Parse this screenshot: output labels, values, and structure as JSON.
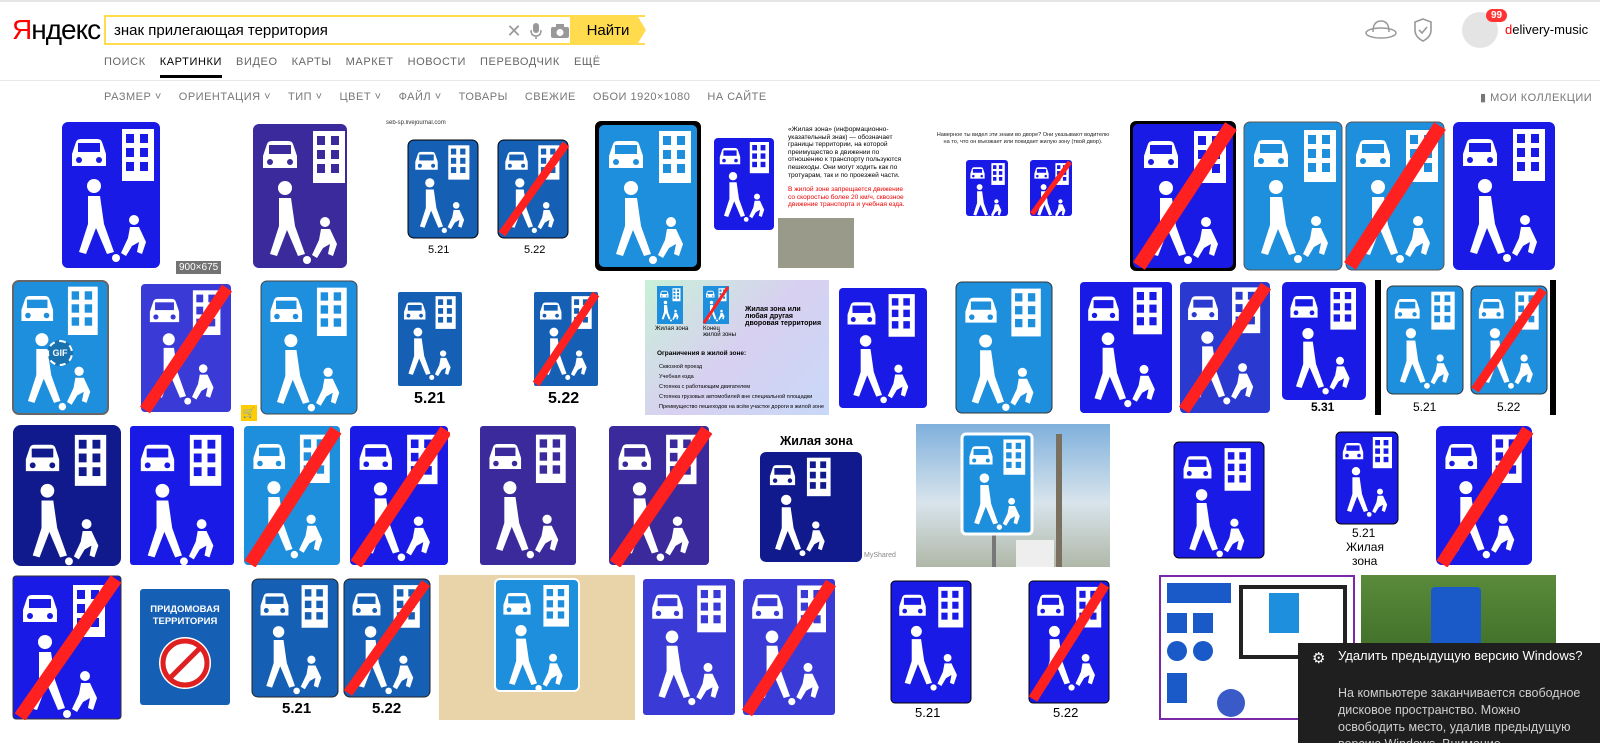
{
  "header": {
    "logo_first": "Я",
    "logo_rest": "ндекс",
    "search_value": "знак прилегающая территория",
    "find_label": "Найти",
    "badge_count": "99",
    "username_first": "d",
    "username_rest": "elivery-music"
  },
  "nav": {
    "items": [
      "ПОИСК",
      "КАРТИНКИ",
      "ВИДЕО",
      "КАРТЫ",
      "МАРКЕТ",
      "НОВОСТИ",
      "ПЕРЕВОДЧИК",
      "ЕЩЁ"
    ]
  },
  "filters": {
    "items": [
      "РАЗМЕР ˅",
      "ОРИЕНТАЦИЯ ˅",
      "ТИП ˅",
      "ЦВЕТ ˅",
      "ФАЙЛ ˅",
      "ТОВАРЫ",
      "СВЕЖИЕ",
      "ОБОИ 1920×1080",
      "НА САЙТЕ"
    ],
    "collections": "МОИ КОЛЛЕКЦИИ"
  },
  "results": {
    "resolution_badge": "900×675",
    "gif_label": "GIF",
    "site_caption": "seb-sp.livejournal.com",
    "label_521": "5.21",
    "label_522": "5.22",
    "label_531": "5.31",
    "zhilaya_zona": "Жилая зона",
    "zona_word": "зона",
    "zhilaya_word": "Жилая",
    "myshared": "MyShared",
    "pridomovaya_line1": "ПРИДОМОВАЯ",
    "pridomovaya_line2": "ТЕРРИТОРИЯ",
    "tile5_head": "«Жилая зона» (информационно-указательный знак) — обозначает границы территории, на которой преимущество в движении по отношению к транспорту пользуются пешеходы. Они могут ходить как по тротуарам, так и по проезжей части.",
    "tile5_red": "В жилой зоне запрещается движение со скоростью более 20 км/ч, сквозное движение транспорта и учебная езда.",
    "tile6_text": "Наверное ты видел эти знаки во дворе? Они указывают водителю на то, что он въезжает или покидает жилую зону (твой двор).",
    "tile14_title": "Жилая зона или любая другая дворовая территория",
    "tile14_l1": "Жилая зона",
    "tile14_l2": "Конец жилой зоны",
    "tile14_head": "Ограничения в жилой зоне:",
    "tile14_items": [
      "Сквозной проезд",
      "Учебная езда",
      "Стоянка с работающим двигателем",
      "Стоянка грузовых автомобилей вне специальной площадки",
      "Преимущество пешеходов на всём участке дороги в жилой зоне"
    ]
  },
  "toast": {
    "title": "Удалить предыдущую версию Windows?",
    "body": "На компьютере заканчивается свободное дисковое пространство. Можно освободить место, удалив предыдущую версию Windows. Внимание"
  },
  "colors": {
    "accent": "#ffdb4d",
    "sign_blue": "#1a1ae6",
    "sign_light": "#1e8fdc",
    "sign_purple": "#3a2a9c",
    "sign_navy": "#101a8c",
    "cross_red": "#ff2020"
  }
}
